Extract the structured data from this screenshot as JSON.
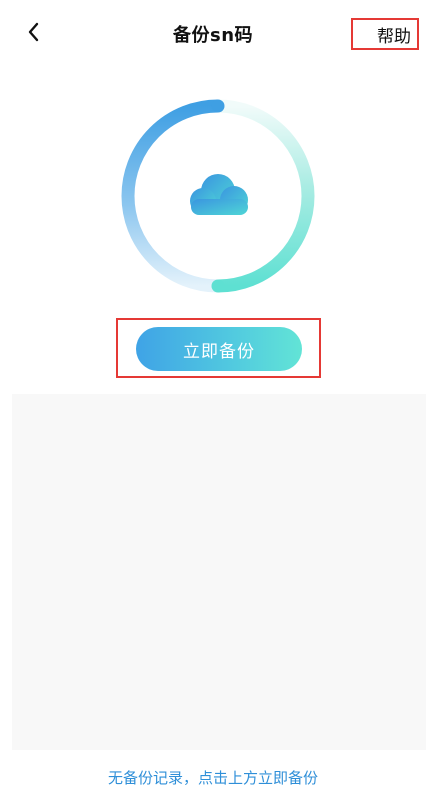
{
  "header": {
    "back_icon": "chevron-left-icon",
    "title": "备份sn码",
    "help_label": "帮助"
  },
  "main": {
    "cloud_icon": "cloud-icon",
    "backup_label": "立即备份",
    "empty_hint": "无备份记录，点击上方立即备份"
  },
  "colors": {
    "accent_blue": "#3fa3e6",
    "accent_teal": "#62e4d6",
    "highlight_red": "#e53935",
    "hint_blue": "#2f8fd8"
  }
}
